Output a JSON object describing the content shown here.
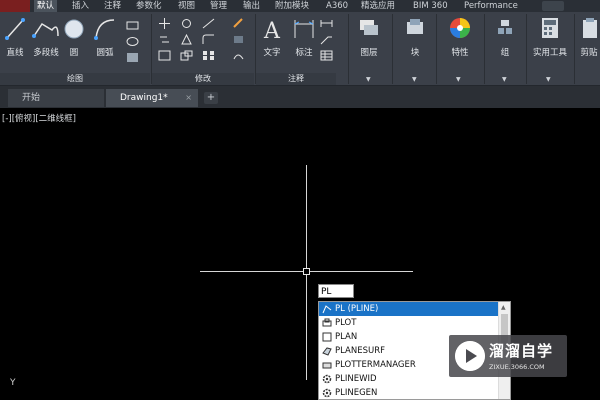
{
  "ribbon_tabs": [
    "默认",
    "插入",
    "注释",
    "参数化",
    "视图",
    "管理",
    "输出",
    "附加模块",
    "A360",
    "精选应用",
    "BIM 360",
    "Performance"
  ],
  "ribbon_active_tab": "默认",
  "panels": {
    "draw": {
      "title": "绘图",
      "tools": [
        "直线",
        "多段线",
        "圆",
        "圆弧"
      ]
    },
    "modify": {
      "title": "修改"
    },
    "annotation": {
      "title": "注释",
      "tools": [
        "文字",
        "标注"
      ]
    },
    "layers": {
      "label": "图层"
    },
    "block": {
      "label": "块"
    },
    "properties": {
      "label": "特性"
    },
    "groups": {
      "label": "组"
    },
    "utilities": {
      "label": "实用工具"
    },
    "clipboard": {
      "label": "剪贴"
    }
  },
  "doc_tabs": [
    {
      "label": "开始"
    },
    {
      "label": "Drawing1*",
      "active": true
    }
  ],
  "add_tab_label": "+",
  "close_tab_label": "×",
  "viewport_label": "[-][俯视][二维线框]",
  "ucs_label": "Y",
  "command_input": "PL",
  "autocomplete": [
    {
      "label": "PL (PLINE)",
      "selected": true,
      "icon": "pline-icon"
    },
    {
      "label": "PLOT",
      "icon": "plot-icon"
    },
    {
      "label": "PLAN",
      "icon": "plan-icon"
    },
    {
      "label": "PLANESURF",
      "icon": "planesurf-icon"
    },
    {
      "label": "PLOTTERMANAGER",
      "icon": "plottermanager-icon"
    },
    {
      "label": "PLINEWID",
      "icon": "gear-icon"
    },
    {
      "label": "PLINEGEN",
      "icon": "gear-icon"
    }
  ],
  "watermark": {
    "title": "溜溜自学",
    "url": "ZIXUE.3066.COM"
  },
  "colors": {
    "selection": "#1a73c7",
    "ribbon_bg": "#3b4049",
    "canvas_bg": "#000000"
  }
}
